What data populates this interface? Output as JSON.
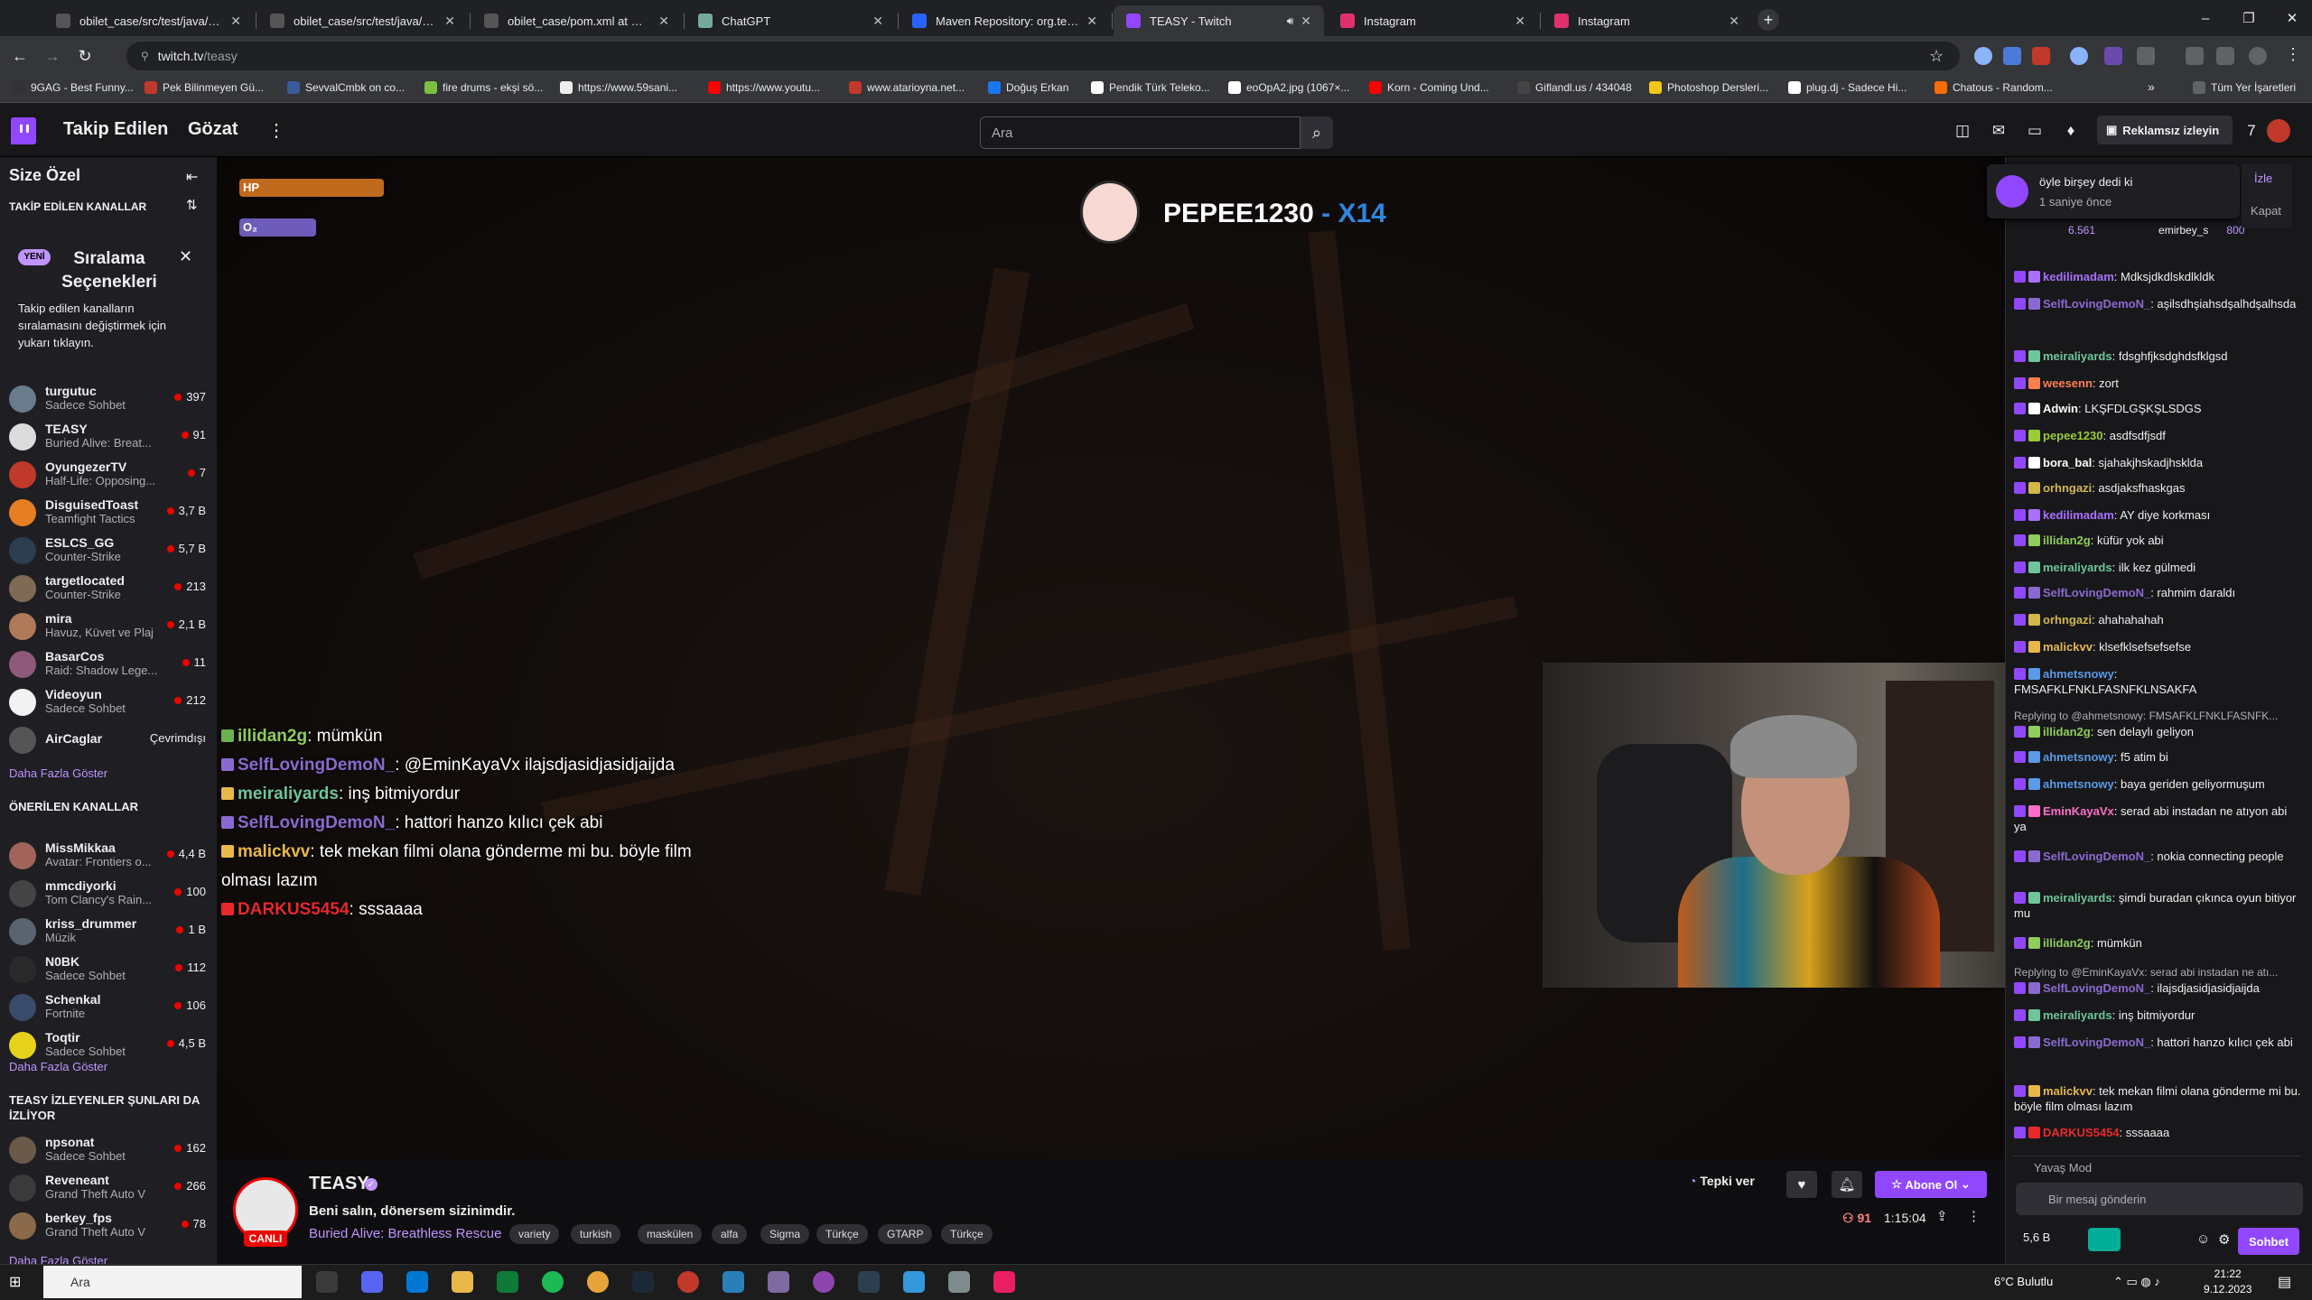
{
  "browser": {
    "tabs": [
      {
        "title": "obilet_case/src/test/java/Step",
        "icon": "github-icon",
        "active": false
      },
      {
        "title": "obilet_case/src/test/java/Step",
        "icon": "github-icon",
        "active": false
      },
      {
        "title": "obilet_case/pom.xml at maste",
        "icon": "github-icon",
        "active": false
      },
      {
        "title": "ChatGPT",
        "icon": "chatgpt-icon",
        "active": false
      },
      {
        "title": "Maven Repository: org.testng",
        "icon": "maven-icon",
        "active": false
      },
      {
        "title": "TEASY - Twitch",
        "icon": "twitch-icon",
        "active": true
      },
      {
        "title": "Instagram",
        "icon": "instagram-icon",
        "active": false
      },
      {
        "title": "Instagram",
        "icon": "instagram-icon",
        "active": false
      }
    ],
    "url_domain": "twitch.tv",
    "url_path": "/teasy",
    "bookmarks": [
      "9GAG - Best Funny...",
      "Pek Bilinmeyen Gü...",
      "SevvalCmbk on co...",
      "fire drums - ekşi sö...",
      "https://www.59sani...",
      "https://www.youtu...",
      "www.atarioyna.net...",
      "Doğuş Erkan",
      "Pendik Türk Teleko...",
      "eoOpA2.jpg (1067×...",
      "Korn - Coming Und...",
      "Giflandl.us / 434048",
      "Photoshop Dersleri...",
      "plug.dj - Sadece Hi...",
      "Chatous - Random..."
    ],
    "bookmarks_more": "»",
    "all_bookmarks": "Tüm Yer İşaretleri"
  },
  "twitch_nav": {
    "following": "Takip Edilen",
    "browse": "Gözat",
    "search_placeholder": "Ara",
    "ad_free": "Reklamsız izleyin"
  },
  "sidebar": {
    "for_you": "Size Özel",
    "followed_header": "TAKİP EDİLEN KANALLAR",
    "promo_badge": "YENİ",
    "promo_title": "Sıralama Seçenekleri",
    "promo_body": "Takip edilen kanalların sıralamasını değiştirmek için yukarı tıklayın.",
    "followed": [
      {
        "name": "turgutuc",
        "game": "Sadece Sohbet",
        "viewers": "397",
        "color": "#6a7b8c"
      },
      {
        "name": "TEASY",
        "game": "Buried Alive: Breat...",
        "viewers": "91",
        "color": "#dcdcdc"
      },
      {
        "name": "OyungezerTV",
        "game": "Half-Life: Opposing...",
        "viewers": "7",
        "color": "#c0392b"
      },
      {
        "name": "DisguisedToast",
        "game": "Teamfight Tactics",
        "viewers": "3,7 B",
        "color": "#e67e22"
      },
      {
        "name": "ESLCS_GG",
        "game": "Counter-Strike",
        "viewers": "5,7 B",
        "color": "#2c3e50"
      },
      {
        "name": "targetlocated",
        "game": "Counter-Strike",
        "viewers": "213",
        "color": "#7f6a55"
      },
      {
        "name": "mira",
        "game": "Havuz, Küvet ve Plaj",
        "viewers": "2,1 B",
        "color": "#b07a5a"
      },
      {
        "name": "BasarCos",
        "game": "Raid: Shadow Lege...",
        "viewers": "11",
        "color": "#8e5a7a"
      },
      {
        "name": "Videoyun",
        "game": "Sadece Sohbet",
        "viewers": "212",
        "color": "#f2f2f2"
      },
      {
        "name": "AirCaglar",
        "game": "",
        "viewers": "Çevrimdışı",
        "color": "#555",
        "offline": true
      }
    ],
    "show_more_1": "Daha Fazla Göster",
    "recommended_header": "ÖNERİLEN KANALLAR",
    "recommended": [
      {
        "name": "MissMikkaa",
        "game": "Avatar: Frontiers o...",
        "viewers": "4,4 B",
        "color": "#a0645a"
      },
      {
        "name": "mmcdiyorki",
        "game": "Tom Clancy's Rain...",
        "viewers": "100",
        "color": "#444"
      },
      {
        "name": "kriss_drummer",
        "game": "Müzik",
        "viewers": "1 B",
        "color": "#5a6470"
      },
      {
        "name": "N0BK",
        "game": "Sadece Sohbet",
        "viewers": "112",
        "color": "#2a2a2a"
      },
      {
        "name": "Schenkal",
        "game": "Fortnite",
        "viewers": "106",
        "color": "#3a4a6a"
      },
      {
        "name": "Toqtir",
        "game": "Sadece Sohbet",
        "viewers": "4,5 B",
        "color": "#e6d21a"
      }
    ],
    "show_more_2": "Daha Fazla Göster",
    "also_header": "TEASY İZLEYENLER ŞUNLARI DA İZLİYOR",
    "also": [
      {
        "name": "npsonat",
        "game": "Sadece Sohbet",
        "viewers": "162",
        "color": "#6a5a4a"
      },
      {
        "name": "Reveneant",
        "game": "Grand Theft Auto V",
        "viewers": "266",
        "color": "#3a3a3a"
      },
      {
        "name": "berkey_fps",
        "game": "Grand Theft Auto V",
        "viewers": "78",
        "color": "#8a6a4a"
      }
    ],
    "show_more_3": "Daha Fazla Göster"
  },
  "player": {
    "hp_label": "HP",
    "o2_label": "O₂",
    "player_name": "PEPEE1230",
    "multiplier": "- X14",
    "overlay_chat": [
      {
        "user": "illidan2g",
        "color": "#8fce5a",
        "text": "mümkün"
      },
      {
        "user": "SelfLovingDemoN_",
        "color": "#8a6ad0",
        "text": "@EminKayaVx ilajsdjasidjasidjaijda"
      },
      {
        "user": "meiraliyards",
        "color": "#6ec59a",
        "text": "inş bitmiyordur"
      },
      {
        "user": "SelfLovingDemoN_",
        "color": "#8a6ad0",
        "text": "hattori hanzo kılıcı çek abi"
      },
      {
        "user": "malickvv",
        "color": "#e8b84a",
        "text": "tek mekan filmi olana gönderme mi bu. böyle film olması lazım"
      },
      {
        "user": "DARKUS5454",
        "color": "#e8282a",
        "text": "sssaaaa"
      }
    ]
  },
  "stream": {
    "channel": "TEASY",
    "live": "CANLI",
    "title": "Beni salın, dönersem sizinimdir.",
    "category": "Buried Alive: Breathless Rescue",
    "tags": [
      "variety",
      "turkish",
      "maskülen",
      "alfa",
      "Sigma",
      "Türkçe",
      "GTARP",
      "Türkçe"
    ],
    "react": "Tepki ver",
    "subscribe": "Abone Ol",
    "viewers": "91",
    "uptime": "1:15:04"
  },
  "chat": {
    "notification": {
      "text": "öyle birşey dedi ki",
      "time": "1 saniye önce",
      "watch": "İzle",
      "close": "Kapat"
    },
    "leaderboard": [
      "6.561",
      "emirbey_s",
      "800"
    ],
    "messages": [
      {
        "user": "kedilimadam",
        "color": "#a970ff",
        "text": "Mdksjdkdlskdlkldk"
      },
      {
        "user": "SelfLovingDemoN_",
        "color": "#8a6ad0",
        "text": "aşilsdhşiahsdşalhdşalhsda"
      },
      {
        "user": "meiraliyards",
        "color": "#6ec59a",
        "text": "fdsghfjksdghdsfklgsd"
      },
      {
        "user": "weesenn",
        "color": "#ff7f50",
        "text": "zort"
      },
      {
        "user": "Adwin",
        "color": "#ffffff",
        "text": "LKŞFDLGŞKŞLSDGS"
      },
      {
        "user": "pepee1230",
        "color": "#9acd32",
        "text": "asdfsdfjsdf"
      },
      {
        "user": "bora_bal",
        "color": "#ffffff",
        "text": "sjahakjhskadjhsklda"
      },
      {
        "user": "orhngazi",
        "color": "#d2b84a",
        "text": "asdjaksfhaskgas"
      },
      {
        "user": "kedilimadam",
        "color": "#a970ff",
        "text": "AY diye korkması"
      },
      {
        "user": "illidan2g",
        "color": "#8fce5a",
        "text": "küfür yok abi"
      },
      {
        "user": "meiraliyards",
        "color": "#6ec59a",
        "text": "ilk kez gülmedi"
      },
      {
        "user": "SelfLovingDemoN_",
        "color": "#8a6ad0",
        "text": "rahmim daraldı"
      },
      {
        "user": "orhngazi",
        "color": "#d2b84a",
        "text": "ahahahahah"
      },
      {
        "user": "malickvv",
        "color": "#e8b84a",
        "text": "klsefklsefsefsefse"
      },
      {
        "user": "ahmetsnowy",
        "color": "#5a9ae6",
        "text": "FMSAFKLFNKLFASNFKLNSAKFA"
      },
      {
        "user": "illidan2g",
        "color": "#8fce5a",
        "text": "sen delaylı geliyon",
        "reply": "Replying to @ahmetsnowy: FMSAFKLFNKLFASNFK..."
      },
      {
        "user": "ahmetsnowy",
        "color": "#5a9ae6",
        "text": "f5 atim bi"
      },
      {
        "user": "ahmetsnowy",
        "color": "#5a9ae6",
        "text": "baya geriden geliyormuşum"
      },
      {
        "user": "EminKayaVx",
        "color": "#ff6ec7",
        "text": "serad abi instadan ne atıyon abi ya"
      },
      {
        "user": "SelfLovingDemoN_",
        "color": "#8a6ad0",
        "text": "nokia connecting people"
      },
      {
        "user": "meiraliyards",
        "color": "#6ec59a",
        "text": "şimdi buradan çıkınca oyun bitiyor mu"
      },
      {
        "user": "illidan2g",
        "color": "#8fce5a",
        "text": "mümkün"
      },
      {
        "user": "SelfLovingDemoN_",
        "color": "#8a6ad0",
        "text": "ilajsdjasidjasidjaijda",
        "reply": "Replying to @EminKayaVx: serad abi instadan ne atı..."
      },
      {
        "user": "meiraliyards",
        "color": "#6ec59a",
        "text": "inş bitmiyordur"
      },
      {
        "user": "SelfLovingDemoN_",
        "color": "#8a6ad0",
        "text": "hattori hanzo kılıcı çek abi"
      },
      {
        "user": "malickvv",
        "color": "#e8b84a",
        "text": "tek mekan filmi olana gönderme mi bu. böyle film olması lazım"
      },
      {
        "user": "DARKUS5454",
        "color": "#e8282a",
        "text": "sssaaaa"
      }
    ],
    "slow_mode": "Yavaş Mod",
    "input_placeholder": "Bir mesaj gönderin",
    "points": "5,6 B",
    "chat_button": "Sohbet"
  },
  "taskbar": {
    "search": "Ara",
    "weather": "6°C  Bulutlu",
    "time": "21:22",
    "date": "9.12.2023"
  }
}
